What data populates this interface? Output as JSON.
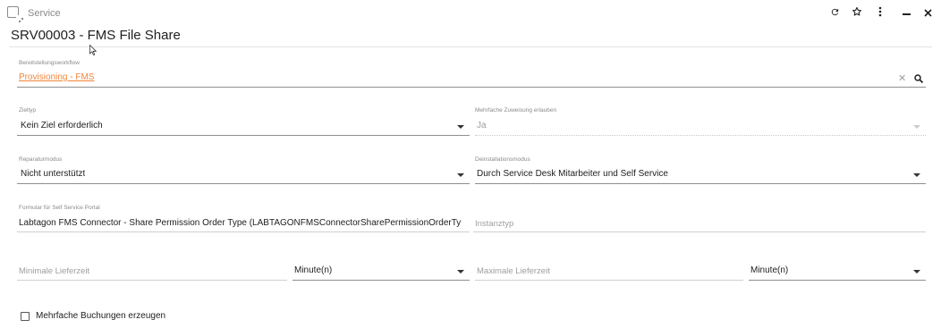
{
  "window": {
    "title": "Service",
    "refresh_icon": "refresh-icon",
    "star_icon": "star-icon",
    "menu_icon": "more-vert-icon",
    "minimize_icon": "minimize-icon",
    "close_icon": "close-icon"
  },
  "page_title": "SRV00003 - FMS File Share",
  "fields": {
    "workflow": {
      "label": "Bereitstellungsworkflow",
      "value": "Provisioning - FMS"
    },
    "zieltyp": {
      "label": "Zieltyp",
      "value": "Kein Ziel erforderlich"
    },
    "mehrfache_zuweisung": {
      "label": "Mehrfache Zuweisung erlauben",
      "value": "Ja"
    },
    "reparaturmodus": {
      "label": "Reparaturmodus",
      "value": "Nicht unterstützt"
    },
    "deinstallationsmodus": {
      "label": "Deinstallationsmodus",
      "value": "Durch Service Desk Mitarbeiter und Self Service"
    },
    "formular": {
      "label": "Formular für Self Service Portal",
      "value": "Labtagon FMS Connector - Share Permission Order Type (LABTAGONFMSConnectorSharePermissionOrderTy"
    },
    "instanztyp": {
      "placeholder": "Instanztyp"
    },
    "min_lieferzeit": {
      "placeholder": "Minimale Lieferzeit",
      "unit": "Minute(n)"
    },
    "max_lieferzeit": {
      "placeholder": "Maximale Lieferzeit",
      "unit": "Minute(n)"
    }
  },
  "checkbox": {
    "label": "Mehrfache Buchungen erzeugen",
    "checked": false
  },
  "colors": {
    "link": "#f2853a",
    "label": "#8a8a8a",
    "text": "#212121"
  }
}
